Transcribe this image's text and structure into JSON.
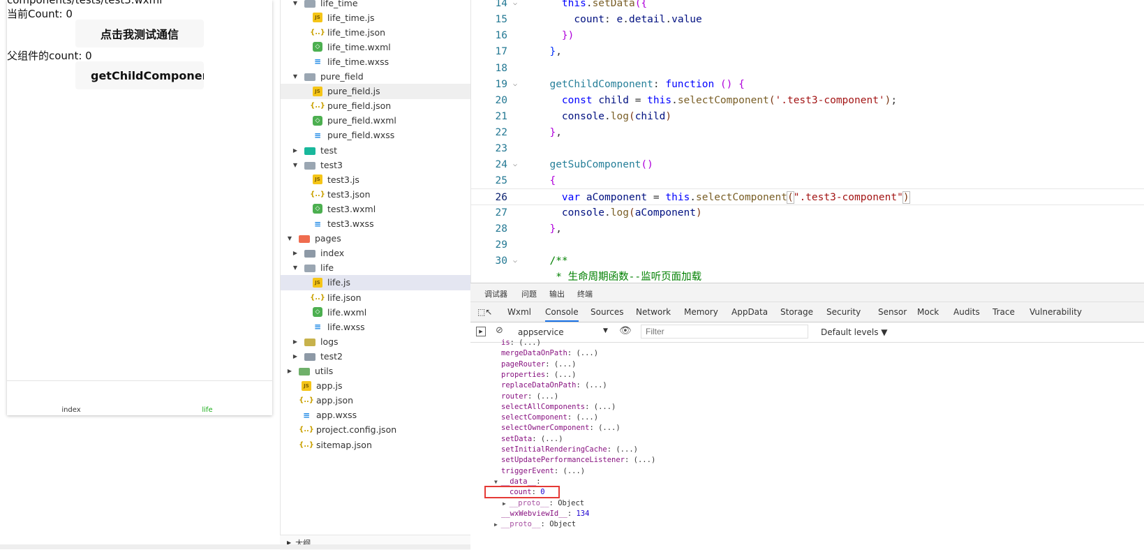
{
  "simulator": {
    "path_text": "components/tests/test3.wxml",
    "count_text": "当前Count: 0",
    "button1": "点击我测试通信",
    "parent_count_text": "父组件的count: 0",
    "button2": "getChildComponent",
    "tabs": [
      {
        "label": "index",
        "color": "#333333"
      },
      {
        "label": "life",
        "color": "#1aad19"
      }
    ]
  },
  "tree": {
    "items": [
      {
        "label": "life_time",
        "kind": "folder-open",
        "depth": 1
      },
      {
        "label": "life_time.js",
        "kind": "js",
        "depth": 2
      },
      {
        "label": "life_time.json",
        "kind": "json",
        "depth": 2
      },
      {
        "label": "life_time.wxml",
        "kind": "wxml",
        "depth": 2
      },
      {
        "label": "life_time.wxss",
        "kind": "wxss",
        "depth": 2
      },
      {
        "label": "pure_field",
        "kind": "folder-open",
        "depth": 1
      },
      {
        "label": "pure_field.js",
        "kind": "js",
        "depth": 2
      },
      {
        "label": "pure_field.json",
        "kind": "json",
        "depth": 2
      },
      {
        "label": "pure_field.wxml",
        "kind": "wxml",
        "depth": 2
      },
      {
        "label": "pure_field.wxss",
        "kind": "wxss",
        "depth": 2
      },
      {
        "label": "test",
        "kind": "folder-teal",
        "depth": 1
      },
      {
        "label": "test3",
        "kind": "folder-open",
        "depth": 1
      },
      {
        "label": "test3.js",
        "kind": "js",
        "depth": 2
      },
      {
        "label": "test3.json",
        "kind": "json",
        "depth": 2
      },
      {
        "label": "test3.wxml",
        "kind": "wxml",
        "depth": 2
      },
      {
        "label": "test3.wxss",
        "kind": "wxss",
        "depth": 2
      },
      {
        "label": "pages",
        "kind": "folder-pages",
        "depth": 0
      },
      {
        "label": "index",
        "kind": "folder",
        "depth": 1
      },
      {
        "label": "life",
        "kind": "folder-open",
        "depth": 1
      },
      {
        "label": "life.js",
        "kind": "js",
        "depth": 2
      },
      {
        "label": "life.json",
        "kind": "json",
        "depth": 2
      },
      {
        "label": "life.wxml",
        "kind": "wxml",
        "depth": 2
      },
      {
        "label": "life.wxss",
        "kind": "wxss",
        "depth": 2
      },
      {
        "label": "logs",
        "kind": "folder-yellow",
        "depth": 1
      },
      {
        "label": "test2",
        "kind": "folder",
        "depth": 1
      },
      {
        "label": "utils",
        "kind": "folder-green",
        "depth": 0
      },
      {
        "label": "app.js",
        "kind": "js",
        "depth": 0
      },
      {
        "label": "app.json",
        "kind": "json",
        "depth": 0
      },
      {
        "label": "app.wxss",
        "kind": "wxss",
        "depth": 0
      },
      {
        "label": "project.config.json",
        "kind": "json",
        "depth": 0
      },
      {
        "label": "sitemap.json",
        "kind": "json",
        "depth": 0
      }
    ],
    "outline_label": "大纲"
  },
  "editor": {
    "line_numbers": [
      "14",
      "15",
      "16",
      "17",
      "18",
      "19",
      "20",
      "21",
      "22",
      "23",
      "24",
      "25",
      "26",
      "27",
      "28",
      "29",
      "30"
    ],
    "current_line": "26"
  },
  "devtools": {
    "top_tabs": [
      "调试器",
      "问题",
      "输出",
      "终端"
    ],
    "panel_tabs": [
      "Wxml",
      "Console",
      "Sources",
      "Network",
      "Memory",
      "AppData",
      "Storage",
      "Security",
      "Sensor",
      "Mock",
      "Audits",
      "Trace",
      "Vulnerability"
    ],
    "active_panel": "Console",
    "context_select": "appservice",
    "filter_placeholder": "Filter",
    "levels": "Default levels ▼",
    "console_rows": [
      {
        "key": "is",
        "value": ": (...)"
      },
      {
        "key": "mergeDataOnPath",
        "value": ": (...)"
      },
      {
        "key": "pageRouter",
        "value": ": (...)"
      },
      {
        "key": "properties",
        "value": ": (...)"
      },
      {
        "key": "replaceDataOnPath",
        "value": ": (...)"
      },
      {
        "key": "router",
        "value": ": (...)"
      },
      {
        "key": "selectAllComponents",
        "value": ": (...)"
      },
      {
        "key": "selectComponent",
        "value": ": (...)"
      },
      {
        "key": "selectOwnerComponent",
        "value": ": (...)"
      },
      {
        "key": "setData",
        "value": ": (...)"
      },
      {
        "key": "setInitialRenderingCache",
        "value": ": (...)"
      },
      {
        "key": "setUpdatePerformanceListener",
        "value": ": (...)"
      },
      {
        "key": "triggerEvent",
        "value": ": (...)"
      }
    ],
    "data_key": "__data__",
    "count_key": "count",
    "count_value": "0",
    "proto_key": "__proto__",
    "proto_value": "Object",
    "webview_key": "__wxWebviewId__",
    "webview_value": "134",
    "proto2_key": "__proto__",
    "proto2_value": "Object",
    "highlight_color": "#e53935"
  }
}
